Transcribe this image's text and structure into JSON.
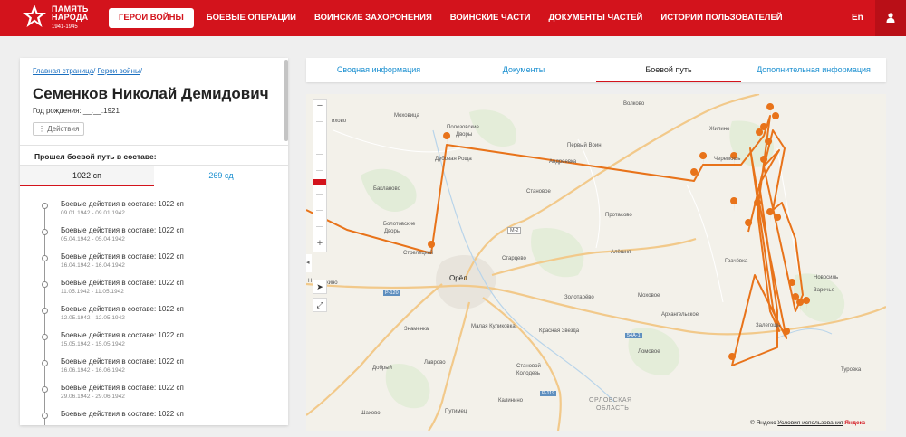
{
  "header": {
    "logo_line1": "ПАМЯТЬ",
    "logo_line2": "НАРОДА",
    "logo_years": "1941-1945",
    "nav": [
      {
        "label": "ГЕРОИ ВОЙНЫ",
        "active": true
      },
      {
        "label": "БОЕВЫЕ ОПЕРАЦИИ"
      },
      {
        "label": "ВОИНСКИЕ ЗАХОРОНЕНИЯ"
      },
      {
        "label": "ВОИНСКИЕ ЧАСТИ"
      },
      {
        "label": "ДОКУМЕНТЫ ЧАСТЕЙ"
      },
      {
        "label": "ИСТОРИИ ПОЛЬЗОВАТЕЛЕЙ"
      }
    ],
    "lang": "En",
    "user_icon": "user-icon"
  },
  "profile": {
    "crumb_home": "Главная страница",
    "crumb_heroes": "Герои войны",
    "name": "Семенков Николай Демидович",
    "birth": "Год рождения: __.__.1921",
    "actions": "⋮ Действия",
    "path_title": "Прошел боевой путь в составе:",
    "units": [
      "1022 сп",
      "269 сд"
    ]
  },
  "timeline": [
    {
      "title": "Боевые действия в составе: 1022 сп",
      "date": "09.01.1942 - 09.01.1942"
    },
    {
      "title": "Боевые действия в составе: 1022 сп",
      "date": "05.04.1942 - 05.04.1942"
    },
    {
      "title": "Боевые действия в составе: 1022 сп",
      "date": "16.04.1942 - 16.04.1942"
    },
    {
      "title": "Боевые действия в составе: 1022 сп",
      "date": "11.05.1942 - 11.05.1942"
    },
    {
      "title": "Боевые действия в составе: 1022 сп",
      "date": "12.05.1942 - 12.05.1942"
    },
    {
      "title": "Боевые действия в составе: 1022 сп",
      "date": "15.05.1942 - 15.05.1942"
    },
    {
      "title": "Боевые действия в составе: 1022 сп",
      "date": "16.06.1942 - 16.06.1942"
    },
    {
      "title": "Боевые действия в составе: 1022 сп",
      "date": "29.06.1942 - 29.06.1942"
    },
    {
      "title": "Боевые действия в составе: 1022 сп",
      "date": ""
    }
  ],
  "tabs": [
    {
      "label": "Сводная информация"
    },
    {
      "label": "Документы"
    },
    {
      "label": "Боевой путь",
      "active": true
    },
    {
      "label": "Дополнительная информация"
    }
  ],
  "map": {
    "labels": [
      {
        "t": "Моховица"
      },
      {
        "t": "ихово"
      },
      {
        "t": "Полозовские"
      },
      {
        "t": "Дворы"
      },
      {
        "t": "Волково"
      },
      {
        "t": "Первый Воин"
      },
      {
        "t": "Жилино"
      },
      {
        "t": "Дубовая Роща"
      },
      {
        "t": "Андреевка"
      },
      {
        "t": "Черемошь"
      },
      {
        "t": "Бакланово"
      },
      {
        "t": "Становое"
      },
      {
        "t": "Протасово"
      },
      {
        "t": "Болотовские"
      },
      {
        "t": "Дворы"
      },
      {
        "t": "Стрелецкий"
      },
      {
        "t": "Алёшня"
      },
      {
        "t": "Старцево"
      },
      {
        "t": "Грачёвка"
      },
      {
        "t": "Орёл"
      },
      {
        "t": "Новосиль"
      },
      {
        "t": "Н"
      },
      {
        "t": "кино"
      },
      {
        "t": "Заречье"
      },
      {
        "t": "Золотарёво"
      },
      {
        "t": "Моховое"
      },
      {
        "t": "Архангельское"
      },
      {
        "t": "Знаменка"
      },
      {
        "t": "Малая Куликовка"
      },
      {
        "t": "Залегощь"
      },
      {
        "t": "Красная Звезда"
      },
      {
        "t": "Ломовое"
      },
      {
        "t": "Добрый"
      },
      {
        "t": "Лаврово"
      },
      {
        "t": "Становой"
      },
      {
        "t": "Колодезь"
      },
      {
        "t": "Туровка"
      },
      {
        "t": "ОРЛОВСКАЯ"
      },
      {
        "t": "ОБЛАСТЬ"
      },
      {
        "t": "Калинино"
      },
      {
        "t": "Шахово"
      },
      {
        "t": "Путимец"
      },
      {
        "t": "М-2"
      },
      {
        "t": "Р-120"
      },
      {
        "t": "Р-119"
      },
      {
        "t": "54А-1"
      }
    ],
    "copyright": "© Яндекс",
    "terms": "Условия использования",
    "brand": "Яндекс",
    "route_color": "#e8731a"
  }
}
